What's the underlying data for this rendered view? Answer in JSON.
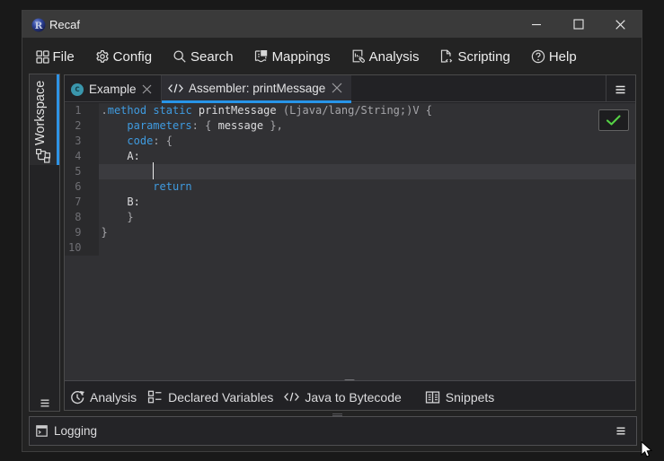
{
  "window": {
    "title": "Recaf"
  },
  "titlebar": {
    "buttons": [
      "minimize",
      "maximize",
      "close"
    ]
  },
  "menu": {
    "items": [
      {
        "label": "File",
        "icon": "workspace-grid-icon"
      },
      {
        "label": "Config",
        "icon": "gear-icon"
      },
      {
        "label": "Search",
        "icon": "magnifier-icon"
      },
      {
        "label": "Mappings",
        "icon": "text-transform-icon"
      },
      {
        "label": "Analysis",
        "icon": "document-chart-edit-icon"
      },
      {
        "label": "Scripting",
        "icon": "file-code-icon"
      },
      {
        "label": "Help",
        "icon": "question-circle-icon"
      }
    ]
  },
  "sidebar": {
    "workspace_label": "Workspace"
  },
  "tabs": [
    {
      "label": "Example",
      "icon": "class-icon",
      "active": false,
      "close": "×"
    },
    {
      "label": "Assembler: printMessage",
      "icon": "code-icon",
      "active": true,
      "close": "×"
    }
  ],
  "editor": {
    "line_numbers": [
      "1",
      "2",
      "3",
      "4",
      "5",
      "6",
      "7",
      "8",
      "9",
      "10"
    ],
    "lines": [
      [
        {
          "t": ".",
          "c": "dim"
        },
        {
          "t": "method",
          "c": "kw"
        },
        {
          "t": " ",
          "c": "def"
        },
        {
          "t": "static",
          "c": "kw"
        },
        {
          "t": " ",
          "c": "def"
        },
        {
          "t": "printMessage",
          "c": "def"
        },
        {
          "t": " ",
          "c": "def"
        },
        {
          "t": "(Ljava/lang/String;)V {",
          "c": "dim"
        }
      ],
      [
        {
          "t": "    ",
          "c": "def"
        },
        {
          "t": "parameters",
          "c": "kw"
        },
        {
          "t": ":",
          "c": "dim"
        },
        {
          "t": " ",
          "c": "def"
        },
        {
          "t": "{",
          "c": "dim"
        },
        {
          "t": " message ",
          "c": "def"
        },
        {
          "t": "},",
          "c": "dim"
        }
      ],
      [
        {
          "t": "    ",
          "c": "def"
        },
        {
          "t": "code",
          "c": "kw"
        },
        {
          "t": ":",
          "c": "dim"
        },
        {
          "t": " ",
          "c": "def"
        },
        {
          "t": "{",
          "c": "dim"
        }
      ],
      [
        {
          "t": "    ",
          "c": "def"
        },
        {
          "t": "A:",
          "c": "def"
        }
      ],
      [],
      [
        {
          "t": "        ",
          "c": "def"
        },
        {
          "t": "return",
          "c": "kw"
        }
      ],
      [
        {
          "t": "    ",
          "c": "def"
        },
        {
          "t": "B:",
          "c": "def"
        }
      ],
      [
        {
          "t": "    ",
          "c": "def"
        },
        {
          "t": "}",
          "c": "dim"
        }
      ],
      [
        {
          "t": "}",
          "c": "dim"
        }
      ],
      []
    ],
    "status_icon": "check"
  },
  "panel_toolbar": {
    "items": [
      {
        "label": "Analysis",
        "icon": "history-clock-icon"
      },
      {
        "label": "Declared Variables",
        "icon": "checklist-icon"
      },
      {
        "label": "Java to Bytecode",
        "icon": "code-icon"
      },
      {
        "label": "Snippets",
        "icon": "book-icon"
      }
    ]
  },
  "logging": {
    "label": "Logging",
    "icon": "console-icon"
  },
  "colors": {
    "accent_blue": "#2795e9",
    "keyword_blue": "#3f9be0",
    "class_teal": "#3a96ad",
    "success_green": "#55d245",
    "titlebar": "#3a3a3a",
    "window_bg": "#232323",
    "code_bg": "#313134",
    "gutter_bg": "#2a2a2c"
  }
}
